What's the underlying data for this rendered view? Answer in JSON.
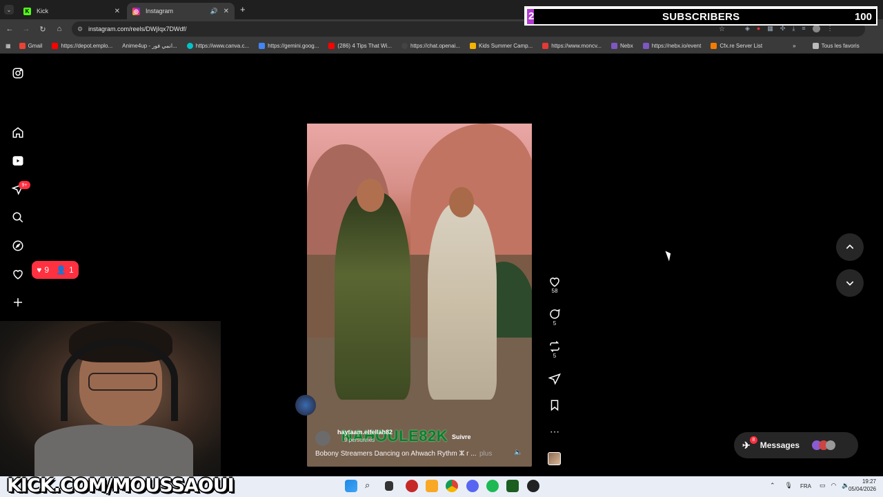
{
  "browser": {
    "tabs": [
      {
        "label": "Kick",
        "active": false,
        "favicon": "kick-logo"
      },
      {
        "label": "Instagram",
        "active": true,
        "favicon": "instagram-logo"
      }
    ],
    "new_tab": "+",
    "address": "instagram.com/reels/DWjIqx7DWdf/",
    "bookmarks": [
      {
        "label": "Gmail",
        "color": "#ea4335"
      },
      {
        "label": "https://depot.emplo...",
        "color": "#ff0000"
      },
      {
        "label": "Anime4up - انمي فور...",
        "color": "#3a3a3a"
      },
      {
        "label": "https://www.canva.c...",
        "color": "#00c4cc"
      },
      {
        "label": "https://gemini.goog...",
        "color": "#4285f4"
      },
      {
        "label": "(286) 4 Tips That Wi...",
        "color": "#ff0000"
      },
      {
        "label": "https://chat.openai...",
        "color": "#444444"
      },
      {
        "label": "Kids Summer Camp...",
        "color": "#f4b400"
      },
      {
        "label": "https://www.moncv...",
        "color": "#e53935"
      },
      {
        "label": "Nebx",
        "color": "#7e57c2"
      },
      {
        "label": "https://nebx.io/event",
        "color": "#7e57c2"
      },
      {
        "label": "Cfx.re Server List",
        "color": "#f57c00"
      }
    ],
    "all_bookmarks": "Tous les favoris"
  },
  "overlay": {
    "subs_current": "2",
    "subs_label": "SUBSCRIBERS",
    "subs_goal": "100",
    "subs_progress": 0.02,
    "accent": "#b23ad1"
  },
  "sidebar": {
    "notif_badge": "9+",
    "activity_likes": "9",
    "activity_follows": "1"
  },
  "reel": {
    "overlay_text": "NAHOULE82K",
    "author": "haytaam.elfellah82",
    "viewers": "9 personnes",
    "follow": "Suivre",
    "caption": "Bobony Streamers Dancing on Ahwach Rythm ⵣ r ...",
    "more": "plus",
    "likes": "58",
    "comments": "5",
    "reposts": "5"
  },
  "messages": {
    "label": "Messages",
    "badge": "8"
  },
  "stream": {
    "url_banner": "KICK.COM/MOUSSAOUI"
  },
  "taskbar": {
    "language": "FRA",
    "time": "19:27",
    "date": "05/04/2026"
  }
}
